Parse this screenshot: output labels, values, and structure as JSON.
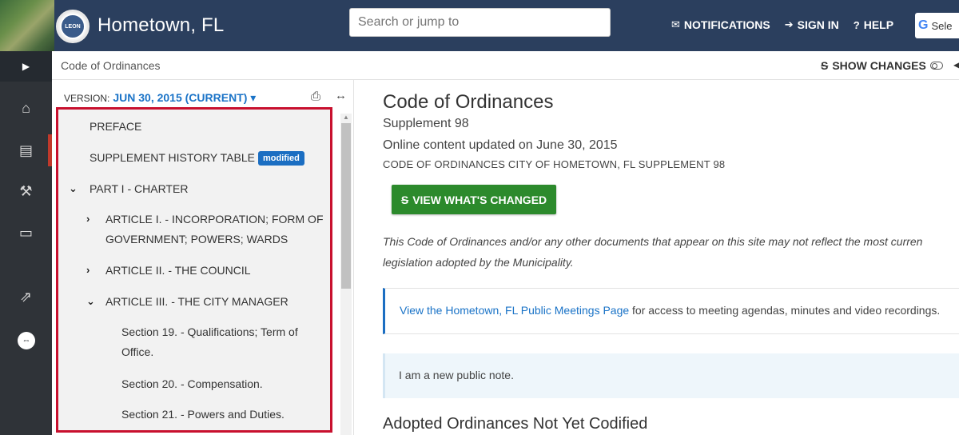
{
  "header": {
    "site_title": "Hometown, FL",
    "seal_text": "LEON",
    "search_placeholder": "Search or jump to",
    "links": [
      {
        "label": "NOTIFICATIONS",
        "icon": "envelope-icon"
      },
      {
        "label": "SIGN IN",
        "icon": "sign-in-icon"
      },
      {
        "label": "HELP",
        "icon": "question-circle-icon"
      }
    ],
    "translate_label": "Sele"
  },
  "rail": {
    "icons": [
      "home-icon",
      "book-icon",
      "gavel-icon",
      "document-icon",
      "external-link-icon",
      "chat-icon"
    ]
  },
  "breadcrumb": "Code of Ordinances",
  "show_changes": "SHOW CHANGES",
  "toc": {
    "version_label": "VERSION:",
    "version_value": "JUN 30, 2015 (CURRENT)",
    "items": [
      {
        "label": "PREFACE"
      },
      {
        "label": "SUPPLEMENT HISTORY TABLE",
        "badge": "modified"
      },
      {
        "label": "PART I - CHARTER"
      },
      {
        "label": "ARTICLE I. - INCORPORATION; FORM OF",
        "label2": "GOVERNMENT; POWERS; WARDS"
      },
      {
        "label": "ARTICLE II. - THE COUNCIL"
      },
      {
        "label": "ARTICLE III. - THE CITY MANAGER"
      },
      {
        "label": "Section 19. - Qualifications; Term of",
        "label2": "Office."
      },
      {
        "label": "Section 20. - Compensation."
      },
      {
        "label": "Section 21. - Powers and Duties."
      }
    ]
  },
  "main": {
    "title": "Code of Ordinances",
    "supplement": "Supplement 98",
    "updated": "Online content updated on June 30, 2015",
    "caps_line": "CODE OF ORDINANCES CITY OF HOMETOWN, FL SUPPLEMENT 98",
    "view_changed_button": "VIEW WHAT'S CHANGED",
    "disclaimer_line1": "This Code of Ordinances and/or any other documents that appear on this site may not reflect the most curren",
    "disclaimer_line2": "legislation adopted by the Municipality.",
    "meetings_link": "View the Hometown, FL Public Meetings Page",
    "meetings_rest": " for access to meeting agendas, minutes and video recordings.",
    "public_note": "I am a new public note.",
    "section_heading": "Adopted Ordinances Not Yet Codified"
  },
  "colors": {
    "header_bg": "#2b3f5e",
    "rail_bg": "#2f3338",
    "accent_blue": "#1a73c7",
    "highlight_red": "#c8102e",
    "button_green": "#2c8a2c"
  }
}
